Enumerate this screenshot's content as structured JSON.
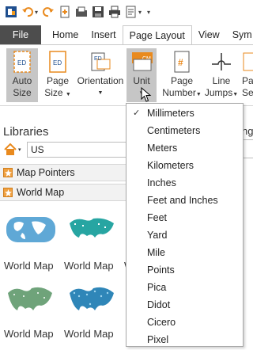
{
  "ribbon_tabs": {
    "file": "File",
    "home": "Home",
    "insert": "Insert",
    "page_layout": "Page Layout",
    "view": "View",
    "symbol": "Sym"
  },
  "ribbon": {
    "auto_size": [
      "Auto",
      "Size"
    ],
    "page_size": [
      "Page",
      "Size"
    ],
    "orientation": "Orientation",
    "unit": [
      "Unit",
      "▾"
    ],
    "page_number": [
      "Page",
      "Number"
    ],
    "line_jumps": [
      "Line",
      "Jumps"
    ],
    "partial": [
      "Pa",
      "Se"
    ],
    "icon_text": {
      "ed": "ED",
      "cm": "CM",
      "hash": "#"
    }
  },
  "libraries": {
    "title": "Libraries",
    "search_value": "US",
    "rows": [
      "Map Pointers",
      "World Map"
    ],
    "thumb_label": "World Map",
    "partial_label": "Wo",
    "side_partial": "ng"
  },
  "unit_menu": {
    "selected": "Millimeters",
    "items": [
      "Millimeters",
      "Centimeters",
      "Meters",
      "Kilometers",
      "Inches",
      "Feet and Inches",
      "Feet",
      "Yard",
      "Mile",
      "Points",
      "Pica",
      "Didot",
      "Cicero",
      "Pixel"
    ]
  },
  "colors": {
    "accent_blue": "#1f6fb8",
    "orange": "#e98a1e",
    "file_tab": "#4d4d4d",
    "selected_button": "#c6c6c6",
    "map_teal": "#27a5a2",
    "map_blue": "#5fa8d6"
  }
}
